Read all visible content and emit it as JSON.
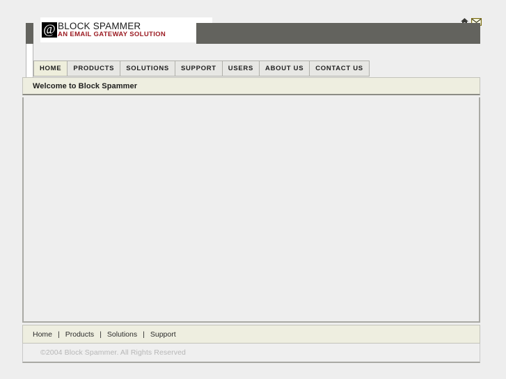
{
  "brand": {
    "at_symbol": "@",
    "title": "BLOCK SPAMMER",
    "tagline": "AN EMAIL GATEWAY SOLUTION",
    "logo_box_color": "#000000",
    "tagline_color": "#9b1b22",
    "banner_color": "#63635e"
  },
  "utility_icons": [
    {
      "name": "home-icon",
      "label": "Home"
    },
    {
      "name": "mail-icon",
      "label": "Contact"
    }
  ],
  "nav": {
    "items": [
      {
        "label": "HOME",
        "active": true
      },
      {
        "label": "PRODUCTS",
        "active": false
      },
      {
        "label": "SOLUTIONS",
        "active": false
      },
      {
        "label": "SUPPORT",
        "active": false
      },
      {
        "label": "USERS",
        "active": false
      },
      {
        "label": "ABOUT US",
        "active": false
      },
      {
        "label": "CONTACT US",
        "active": false
      }
    ],
    "active_tab_color": "#eeeedc",
    "tab_color": "#e7e7e4"
  },
  "page": {
    "title": "Welcome to Block Spammer",
    "title_bar_color": "#eeeee0",
    "content_background": "#eeeeee",
    "content_body": ""
  },
  "footer": {
    "links": [
      "Home",
      "Products",
      "Solutions",
      "Support"
    ],
    "separator": "|",
    "bar_color": "#eeeee0",
    "copyright": "©2004 Block Spammer. All Rights Reserved",
    "copyright_color": "#b6b6b6"
  }
}
